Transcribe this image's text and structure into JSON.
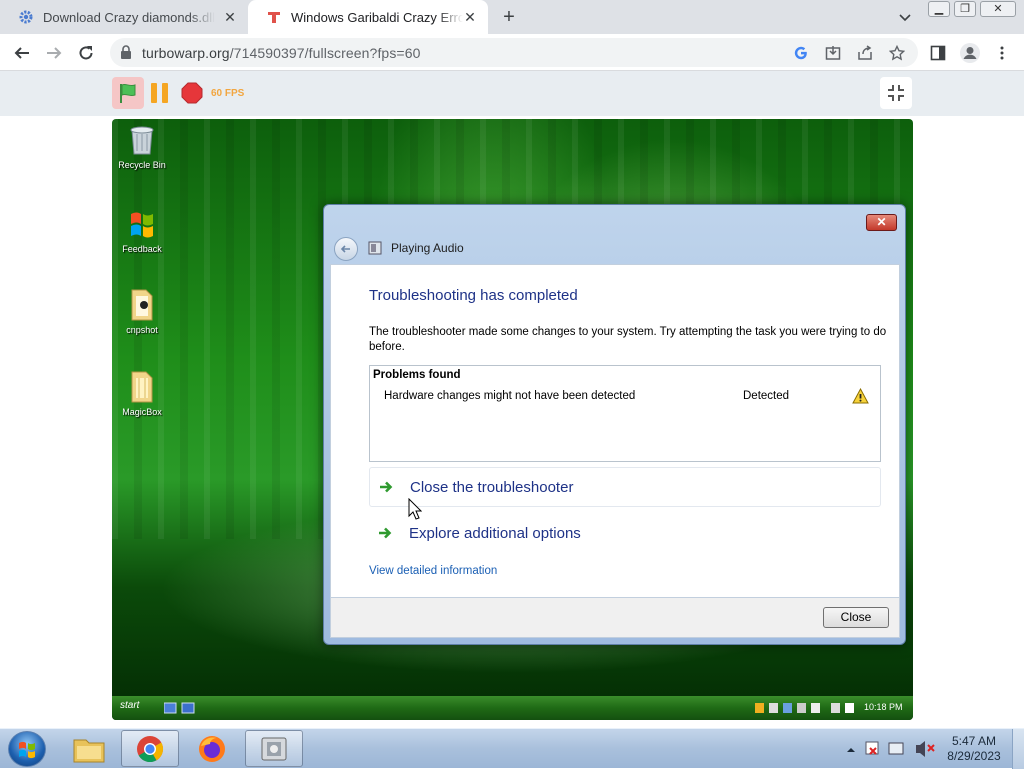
{
  "browser": {
    "tabs": [
      {
        "title": "Download Crazy diamonds.dll for",
        "favicon": "gear-favicon",
        "active": false
      },
      {
        "title": "Windows Garibaldi Crazy Error M",
        "favicon": "turbowarp-favicon",
        "active": true
      }
    ],
    "url": {
      "host": "turbowarp.org",
      "path": "/714590397/fullscreen?fps=60"
    },
    "colors": {
      "tab_bar": "#dee1e6",
      "toolbar": "#ffffff",
      "omnibox": "#f1f3f4"
    }
  },
  "turbowarp": {
    "fps_label": "60 FPS",
    "colors": {
      "flag": "#4cbf56",
      "pause": "#f5a623",
      "stop": "#e6363a",
      "fps": "#f2a640"
    }
  },
  "desktop": {
    "icons": [
      {
        "label": "Recycle Bin",
        "icon": "recycle-bin-icon"
      },
      {
        "label": "Feedback",
        "icon": "windows-flag-icon"
      },
      {
        "label": "cnpshot",
        "icon": "folder-icon"
      },
      {
        "label": "MagicBox",
        "icon": "folder-icon"
      }
    ],
    "inner_taskbar": {
      "start_label": "start",
      "clock": "10:18 PM"
    }
  },
  "dialog": {
    "title": "Playing Audio",
    "heading": "Troubleshooting has completed",
    "description": "The troubleshooter made some changes to your system. Try attempting the task you were trying to do before.",
    "problems_header": "Problems found",
    "problems": [
      {
        "name": "Hardware changes might not have been detected",
        "status": "Detected",
        "icon": "warning-icon"
      }
    ],
    "options": [
      {
        "label": "Close the troubleshooter",
        "icon": "green-arrow-icon"
      },
      {
        "label": "Explore additional options",
        "icon": "green-arrow-icon"
      }
    ],
    "link": "View detailed information",
    "close_button": "Close"
  },
  "taskbar": {
    "apps": [
      "explorer-icon",
      "chrome-icon",
      "firefox-icon",
      "disk-app-icon"
    ],
    "time": "5:47 AM",
    "date": "8/29/2023"
  }
}
